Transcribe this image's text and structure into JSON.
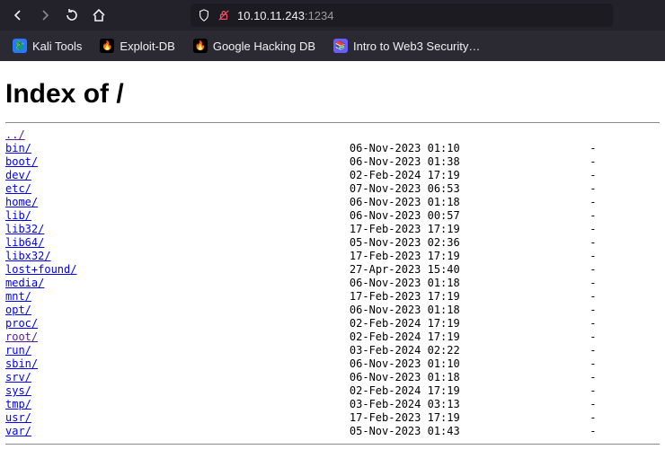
{
  "address": {
    "host": "10.10.11.243",
    "port": ":1234"
  },
  "bookmarks": [
    {
      "label": "Kali Tools",
      "favicon_bg": "#2777ff",
      "favicon_glyph": "🐉"
    },
    {
      "label": "Exploit-DB",
      "favicon_bg": "#000",
      "favicon_glyph": "🔥"
    },
    {
      "label": "Google Hacking DB",
      "favicon_bg": "#000",
      "favicon_glyph": "🔥"
    },
    {
      "label": "Intro to Web3 Security…",
      "favicon_bg": "#6b5cff",
      "favicon_glyph": "📚"
    }
  ],
  "page": {
    "heading": "Index of /",
    "name_col_width": 53,
    "date_col_width": 34,
    "entries": [
      {
        "name": "../",
        "date": "",
        "size": "",
        "visited": true
      },
      {
        "name": "bin/",
        "date": "06-Nov-2023 01:10",
        "size": "-"
      },
      {
        "name": "boot/",
        "date": "06-Nov-2023 01:38",
        "size": "-"
      },
      {
        "name": "dev/",
        "date": "02-Feb-2024 17:19",
        "size": "-"
      },
      {
        "name": "etc/",
        "date": "07-Nov-2023 06:53",
        "size": "-"
      },
      {
        "name": "home/",
        "date": "06-Nov-2023 01:18",
        "size": "-"
      },
      {
        "name": "lib/",
        "date": "06-Nov-2023 00:57",
        "size": "-"
      },
      {
        "name": "lib32/",
        "date": "17-Feb-2023 17:19",
        "size": "-"
      },
      {
        "name": "lib64/",
        "date": "05-Nov-2023 02:36",
        "size": "-"
      },
      {
        "name": "libx32/",
        "date": "17-Feb-2023 17:19",
        "size": "-"
      },
      {
        "name": "lost+found/",
        "date": "27-Apr-2023 15:40",
        "size": "-"
      },
      {
        "name": "media/",
        "date": "06-Nov-2023 01:18",
        "size": "-"
      },
      {
        "name": "mnt/",
        "date": "17-Feb-2023 17:19",
        "size": "-"
      },
      {
        "name": "opt/",
        "date": "06-Nov-2023 01:18",
        "size": "-"
      },
      {
        "name": "proc/",
        "date": "02-Feb-2024 17:19",
        "size": "-"
      },
      {
        "name": "root/",
        "date": "02-Feb-2024 17:19",
        "size": "-",
        "visited": true
      },
      {
        "name": "run/",
        "date": "03-Feb-2024 02:22",
        "size": "-"
      },
      {
        "name": "sbin/",
        "date": "06-Nov-2023 01:10",
        "size": "-"
      },
      {
        "name": "srv/",
        "date": "06-Nov-2023 01:18",
        "size": "-"
      },
      {
        "name": "sys/",
        "date": "02-Feb-2024 17:19",
        "size": "-"
      },
      {
        "name": "tmp/",
        "date": "03-Feb-2024 03:13",
        "size": "-"
      },
      {
        "name": "usr/",
        "date": "17-Feb-2023 17:19",
        "size": "-"
      },
      {
        "name": "var/",
        "date": "05-Nov-2023 01:43",
        "size": "-"
      }
    ]
  }
}
